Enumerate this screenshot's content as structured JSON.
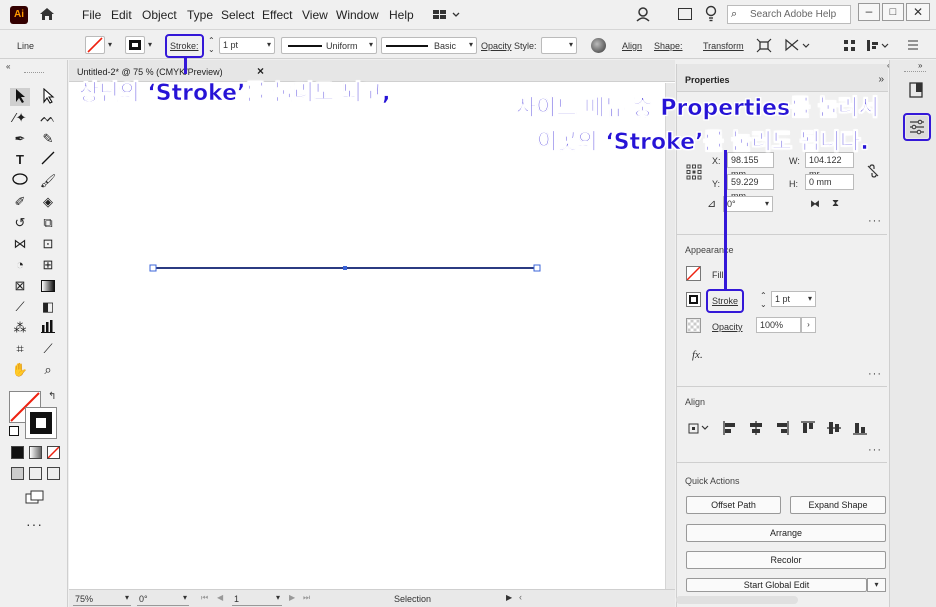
{
  "menu": {
    "logo": "Ai",
    "items": [
      "File",
      "Edit",
      "Object",
      "Type",
      "Select",
      "Effect",
      "View",
      "Window",
      "Help"
    ],
    "search_placeholder": "Search Adobe Help"
  },
  "control_bar": {
    "object_type": "Line",
    "stroke_label": "Stroke:",
    "stroke_weight": "1 pt",
    "profile_label": "Uniform",
    "brush_label": "Basic",
    "opacity_label": "Opacity",
    "style_label": "Style:",
    "align_label": "Align",
    "shape_label": "Shape:",
    "transform_label": "Transform"
  },
  "document": {
    "tab_title": "Untitled-2* @ 75 % (CMYK/Preview)",
    "tab_close": "×",
    "zoom": "75%",
    "rotation": "0°",
    "artboard": "1",
    "status": "Selection",
    "line_color": "#2b3b82"
  },
  "properties": {
    "panel_title": "Properties",
    "transform": {
      "x_label": "X:",
      "x_value": "98.155 mm",
      "w_label": "W:",
      "w_value": "104.122 mr",
      "y_label": "Y:",
      "y_value": "59.229 mm",
      "h_label": "H:",
      "h_value": "0 mm",
      "angle_value": "0°"
    },
    "appearance": {
      "title": "Appearance",
      "fill_label": "Fill",
      "stroke_label": "Stroke",
      "stroke_weight": "1 pt",
      "opacity_label": "Opacity",
      "opacity_value": "100%",
      "fx_label": "fx."
    },
    "align": {
      "title": "Align"
    },
    "quick_actions": {
      "title": "Quick Actions",
      "buttons": [
        "Offset Path",
        "Expand Shape",
        "Arrange",
        "Recolor",
        "Start Global Edit"
      ]
    }
  },
  "callouts": {
    "top": "상단의 ‘Stroke’를 눌러도 되고,",
    "side_line1": "사이드 메뉴 중 Properties를 눌러서",
    "side_line2": "이곳의 ‘Stroke’를 눌러도 됩니다.",
    "color": "#3418d8"
  }
}
